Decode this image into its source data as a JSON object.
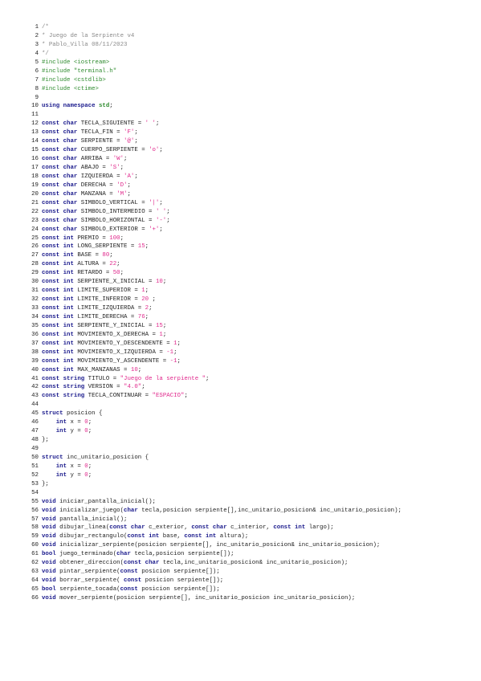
{
  "document": {
    "lines": [
      {
        "n": "1",
        "tokens": [
          [
            "comment",
            "/*"
          ]
        ]
      },
      {
        "n": "2",
        "tokens": [
          [
            "comment",
            "* Juego de la Serpiente v4"
          ]
        ]
      },
      {
        "n": "3",
        "tokens": [
          [
            "comment",
            "* Pablo_Villa 08/11/2023"
          ]
        ]
      },
      {
        "n": "4",
        "tokens": [
          [
            "comment",
            "*/"
          ]
        ]
      },
      {
        "n": "5",
        "tokens": [
          [
            "pre",
            "#include <iostream>"
          ]
        ]
      },
      {
        "n": "6",
        "tokens": [
          [
            "pre",
            "#include \"terminal.h\""
          ]
        ]
      },
      {
        "n": "7",
        "tokens": [
          [
            "pre",
            "#include <cstdlib>"
          ]
        ]
      },
      {
        "n": "8",
        "tokens": [
          [
            "pre",
            "#include <ctime>"
          ]
        ]
      },
      {
        "n": "9",
        "tokens": []
      },
      {
        "n": "10",
        "tokens": [
          [
            "kw",
            "using namespace"
          ],
          [
            "op",
            " "
          ],
          [
            "ns",
            "std"
          ],
          [
            "op",
            ";"
          ]
        ]
      },
      {
        "n": "11",
        "tokens": []
      },
      {
        "n": "12",
        "tokens": [
          [
            "kw",
            "const char"
          ],
          [
            "ident",
            " TECLA_SIGUIENTE = "
          ],
          [
            "str",
            "' '"
          ],
          [
            "op",
            ";"
          ]
        ]
      },
      {
        "n": "13",
        "tokens": [
          [
            "kw",
            "const char"
          ],
          [
            "ident",
            " TECLA_FIN = "
          ],
          [
            "str",
            "'F'"
          ],
          [
            "op",
            ";"
          ]
        ]
      },
      {
        "n": "14",
        "tokens": [
          [
            "kw",
            "const char"
          ],
          [
            "ident",
            " SERPIENTE = "
          ],
          [
            "str",
            "'@'"
          ],
          [
            "op",
            ";"
          ]
        ]
      },
      {
        "n": "15",
        "tokens": [
          [
            "kw",
            "const char"
          ],
          [
            "ident",
            " CUERPO_SERPIENTE = "
          ],
          [
            "str",
            "'o'"
          ],
          [
            "op",
            ";"
          ]
        ]
      },
      {
        "n": "16",
        "tokens": [
          [
            "kw",
            "const char"
          ],
          [
            "ident",
            " ARRIBA = "
          ],
          [
            "str",
            "'W'"
          ],
          [
            "op",
            ";"
          ]
        ]
      },
      {
        "n": "17",
        "tokens": [
          [
            "kw",
            "const char"
          ],
          [
            "ident",
            " ABAJO = "
          ],
          [
            "str",
            "'S'"
          ],
          [
            "op",
            ";"
          ]
        ]
      },
      {
        "n": "18",
        "tokens": [
          [
            "kw",
            "const char"
          ],
          [
            "ident",
            " IZQUIERDA = "
          ],
          [
            "str",
            "'A'"
          ],
          [
            "op",
            ";"
          ]
        ]
      },
      {
        "n": "19",
        "tokens": [
          [
            "kw",
            "const char"
          ],
          [
            "ident",
            " DERECHA = "
          ],
          [
            "str",
            "'D'"
          ],
          [
            "op",
            ";"
          ]
        ]
      },
      {
        "n": "20",
        "tokens": [
          [
            "kw",
            "const char"
          ],
          [
            "ident",
            " MANZANA = "
          ],
          [
            "str",
            "'M'"
          ],
          [
            "op",
            ";"
          ]
        ]
      },
      {
        "n": "21",
        "tokens": [
          [
            "kw",
            "const char"
          ],
          [
            "ident",
            " SIMBOLO_VERTICAL = "
          ],
          [
            "str",
            "'|'"
          ],
          [
            "op",
            ";"
          ]
        ]
      },
      {
        "n": "22",
        "tokens": [
          [
            "kw",
            "const char"
          ],
          [
            "ident",
            " SIMBOLO_INTERMEDIO = "
          ],
          [
            "str",
            "' '"
          ],
          [
            "op",
            ";"
          ]
        ]
      },
      {
        "n": "23",
        "tokens": [
          [
            "kw",
            "const char"
          ],
          [
            "ident",
            " SIMBOLO_HORIZONTAL = "
          ],
          [
            "str",
            "'-'"
          ],
          [
            "op",
            ";"
          ]
        ]
      },
      {
        "n": "24",
        "tokens": [
          [
            "kw",
            "const char"
          ],
          [
            "ident",
            " SIMBOLO_EXTERIOR = "
          ],
          [
            "str",
            "'+'"
          ],
          [
            "op",
            ";"
          ]
        ]
      },
      {
        "n": "25",
        "tokens": [
          [
            "kw",
            "const int"
          ],
          [
            "ident",
            " PREMIO = "
          ],
          [
            "num-lit",
            "100"
          ],
          [
            "op",
            ";"
          ]
        ]
      },
      {
        "n": "26",
        "tokens": [
          [
            "kw",
            "const int"
          ],
          [
            "ident",
            " LONG_SERPIENTE = "
          ],
          [
            "num-lit",
            "15"
          ],
          [
            "op",
            ";"
          ]
        ]
      },
      {
        "n": "27",
        "tokens": [
          [
            "kw",
            "const int"
          ],
          [
            "ident",
            " BASE = "
          ],
          [
            "num-lit",
            "80"
          ],
          [
            "op",
            ";"
          ]
        ]
      },
      {
        "n": "28",
        "tokens": [
          [
            "kw",
            "const int"
          ],
          [
            "ident",
            " ALTURA = "
          ],
          [
            "num-lit",
            "22"
          ],
          [
            "op",
            ";"
          ]
        ]
      },
      {
        "n": "29",
        "tokens": [
          [
            "kw",
            "const int"
          ],
          [
            "ident",
            " RETARDO = "
          ],
          [
            "num-lit",
            "50"
          ],
          [
            "op",
            ";"
          ]
        ]
      },
      {
        "n": "30",
        "tokens": [
          [
            "kw",
            "const int"
          ],
          [
            "ident",
            " SERPIENTE_X_INICIAL = "
          ],
          [
            "num-lit",
            "10"
          ],
          [
            "op",
            ";"
          ]
        ]
      },
      {
        "n": "31",
        "tokens": [
          [
            "kw",
            "const int"
          ],
          [
            "ident",
            " LIMITE_SUPERIOR = "
          ],
          [
            "num-lit",
            "1"
          ],
          [
            "op",
            ";"
          ]
        ]
      },
      {
        "n": "32",
        "tokens": [
          [
            "kw",
            "const int"
          ],
          [
            "ident",
            " LIMITE_INFERIOR = "
          ],
          [
            "num-lit",
            "20"
          ],
          [
            "op",
            " ;"
          ]
        ]
      },
      {
        "n": "33",
        "tokens": [
          [
            "kw",
            "const int"
          ],
          [
            "ident",
            " LIMITE_IZQUIERDA = "
          ],
          [
            "num-lit",
            "2"
          ],
          [
            "op",
            ";"
          ]
        ]
      },
      {
        "n": "34",
        "tokens": [
          [
            "kw",
            "const int"
          ],
          [
            "ident",
            " LIMITE_DERECHA = "
          ],
          [
            "num-lit",
            "76"
          ],
          [
            "op",
            ";"
          ]
        ]
      },
      {
        "n": "35",
        "tokens": [
          [
            "kw",
            "const int"
          ],
          [
            "ident",
            " SERPIENTE_Y_INICIAL = "
          ],
          [
            "num-lit",
            "15"
          ],
          [
            "op",
            ";"
          ]
        ]
      },
      {
        "n": "36",
        "tokens": [
          [
            "kw",
            "const int"
          ],
          [
            "ident",
            " MOVIMIENTO_X_DERECHA = "
          ],
          [
            "num-lit",
            "1"
          ],
          [
            "op",
            ";"
          ]
        ]
      },
      {
        "n": "37",
        "tokens": [
          [
            "kw",
            "const int"
          ],
          [
            "ident",
            " MOVIMIENTO_Y_DESCENDENTE = "
          ],
          [
            "num-lit",
            "1"
          ],
          [
            "op",
            ";"
          ]
        ]
      },
      {
        "n": "38",
        "tokens": [
          [
            "kw",
            "const int"
          ],
          [
            "ident",
            " MOVIMIENTO_X_IZQUIERDA = "
          ],
          [
            "num-lit",
            "-1"
          ],
          [
            "op",
            ";"
          ]
        ]
      },
      {
        "n": "39",
        "tokens": [
          [
            "kw",
            "const int"
          ],
          [
            "ident",
            " MOVIMIENTO_Y_ASCENDENTE = "
          ],
          [
            "num-lit",
            "-1"
          ],
          [
            "op",
            ";"
          ]
        ]
      },
      {
        "n": "40",
        "tokens": [
          [
            "kw",
            "const int"
          ],
          [
            "ident",
            " MAX_MANZANAS = "
          ],
          [
            "num-lit",
            "10"
          ],
          [
            "op",
            ";"
          ]
        ]
      },
      {
        "n": "41",
        "tokens": [
          [
            "kw",
            "const string"
          ],
          [
            "ident",
            " TITULO = "
          ],
          [
            "str",
            "\"Juego de la serpiente \""
          ],
          [
            "op",
            ";"
          ]
        ]
      },
      {
        "n": "42",
        "tokens": [
          [
            "kw",
            "const string"
          ],
          [
            "ident",
            " VERSION = "
          ],
          [
            "str",
            "\"4.0\""
          ],
          [
            "op",
            ";"
          ]
        ]
      },
      {
        "n": "43",
        "tokens": [
          [
            "kw",
            "const string"
          ],
          [
            "ident",
            " TECLA_CONTINUAR = "
          ],
          [
            "str",
            "\"ESPACIO\""
          ],
          [
            "op",
            ";"
          ]
        ]
      },
      {
        "n": "44",
        "tokens": []
      },
      {
        "n": "45",
        "tokens": [
          [
            "kw",
            "struct"
          ],
          [
            "ident",
            " posicion {"
          ]
        ]
      },
      {
        "n": "46",
        "tokens": [
          [
            "ident",
            "    "
          ],
          [
            "kw",
            "int"
          ],
          [
            "ident",
            " x = "
          ],
          [
            "num-lit",
            "0"
          ],
          [
            "op",
            ";"
          ]
        ]
      },
      {
        "n": "47",
        "tokens": [
          [
            "ident",
            "    "
          ],
          [
            "kw",
            "int"
          ],
          [
            "ident",
            " y = "
          ],
          [
            "num-lit",
            "0"
          ],
          [
            "op",
            ";"
          ]
        ]
      },
      {
        "n": "48",
        "tokens": [
          [
            "ident",
            "};"
          ]
        ]
      },
      {
        "n": "49",
        "tokens": []
      },
      {
        "n": "50",
        "tokens": [
          [
            "kw",
            "struct"
          ],
          [
            "ident",
            " inc_unitario_posicion {"
          ]
        ]
      },
      {
        "n": "51",
        "tokens": [
          [
            "ident",
            "    "
          ],
          [
            "kw",
            "int"
          ],
          [
            "ident",
            " x = "
          ],
          [
            "num-lit",
            "0"
          ],
          [
            "op",
            ";"
          ]
        ]
      },
      {
        "n": "52",
        "tokens": [
          [
            "ident",
            "    "
          ],
          [
            "kw",
            "int"
          ],
          [
            "ident",
            " y = "
          ],
          [
            "num-lit",
            "0"
          ],
          [
            "op",
            ";"
          ]
        ]
      },
      {
        "n": "53",
        "tokens": [
          [
            "ident",
            "};"
          ]
        ]
      },
      {
        "n": "54",
        "tokens": []
      },
      {
        "n": "55",
        "tokens": [
          [
            "kw",
            "void"
          ],
          [
            "ident",
            " iniciar_pantalla_inicial();"
          ]
        ]
      },
      {
        "n": "56",
        "tokens": [
          [
            "kw",
            "void"
          ],
          [
            "ident",
            " inicializar_juego("
          ],
          [
            "kw",
            "char"
          ],
          [
            "ident",
            " tecla,posicion serpiente[],inc_unitario_posicion& inc_unitario_posicion);"
          ]
        ]
      },
      {
        "n": "57",
        "tokens": [
          [
            "kw",
            "void"
          ],
          [
            "ident",
            " pantalla_inicial();"
          ]
        ]
      },
      {
        "n": "58",
        "tokens": [
          [
            "kw",
            "void"
          ],
          [
            "ident",
            " dibujar_linea("
          ],
          [
            "kw",
            "const char"
          ],
          [
            "ident",
            " c_exterior, "
          ],
          [
            "kw",
            "const char"
          ],
          [
            "ident",
            " c_interior, "
          ],
          [
            "kw",
            "const int"
          ],
          [
            "ident",
            " largo);"
          ]
        ]
      },
      {
        "n": "59",
        "tokens": [
          [
            "kw",
            "void"
          ],
          [
            "ident",
            " dibujar_rectangulo("
          ],
          [
            "kw",
            "const int"
          ],
          [
            "ident",
            " base, "
          ],
          [
            "kw",
            "const int"
          ],
          [
            "ident",
            " altura);"
          ]
        ]
      },
      {
        "n": "60",
        "tokens": [
          [
            "kw",
            "void"
          ],
          [
            "ident",
            " inicializar_serpiente(posicion serpiente[], inc_unitario_posicion& inc_unitario_posicion);"
          ]
        ]
      },
      {
        "n": "61",
        "tokens": [
          [
            "kw",
            "bool"
          ],
          [
            "ident",
            " juego_terminado("
          ],
          [
            "kw",
            "char"
          ],
          [
            "ident",
            " tecla,posicion serpiente[]);"
          ]
        ]
      },
      {
        "n": "62",
        "tokens": [
          [
            "kw",
            "void"
          ],
          [
            "ident",
            " obtener_direccion("
          ],
          [
            "kw",
            "const char"
          ],
          [
            "ident",
            " tecla,inc_unitario_posicion& inc_unitario_posicion);"
          ]
        ]
      },
      {
        "n": "63",
        "tokens": [
          [
            "kw",
            "void"
          ],
          [
            "ident",
            " pintar_serpiente("
          ],
          [
            "kw",
            "const"
          ],
          [
            "ident",
            " posicion serpiente[]);"
          ]
        ]
      },
      {
        "n": "64",
        "tokens": [
          [
            "kw",
            "void"
          ],
          [
            "ident",
            " borrar_serpiente( "
          ],
          [
            "kw",
            "const"
          ],
          [
            "ident",
            " posicion serpiente[]);"
          ]
        ]
      },
      {
        "n": "65",
        "tokens": [
          [
            "kw",
            "bool"
          ],
          [
            "ident",
            " serpiente_tocada("
          ],
          [
            "kw",
            "const"
          ],
          [
            "ident",
            " posicion serpiente[]);"
          ]
        ]
      },
      {
        "n": "66",
        "tokens": [
          [
            "kw",
            "void"
          ],
          [
            "ident",
            " mover_serpiente(posicion serpiente[], inc_unitario_posicion inc_unitario_posicion);"
          ]
        ]
      }
    ]
  },
  "colors": {
    "background": "#ffffff",
    "comment": "#8a8a8a",
    "preprocessor": "#2e8b2e",
    "keyword": "#1a1a8c",
    "literal": "#e0288c",
    "text": "#222222"
  }
}
